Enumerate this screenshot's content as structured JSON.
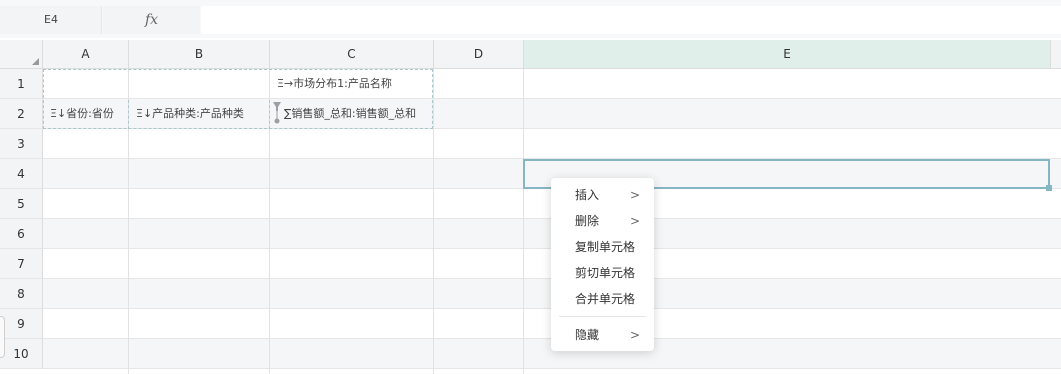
{
  "formula_bar": {
    "cell_ref": "E4",
    "fx_label": "fx",
    "formula_value": ""
  },
  "columns": [
    "A",
    "B",
    "C",
    "D",
    "E"
  ],
  "rows": [
    "1",
    "2",
    "3",
    "4",
    "5",
    "6",
    "7",
    "8",
    "9",
    "10"
  ],
  "cells": {
    "C1": "Ξ→市场分布1:产品名称",
    "A2": "Ξ↓省份:省份",
    "B2": "Ξ↓产品种类:产品种类",
    "C2": "∑销售额_总和:销售额_总和"
  },
  "context_menu": {
    "items": [
      {
        "label": "插入",
        "arrow": ">"
      },
      {
        "label": "删除",
        "arrow": ">"
      },
      {
        "label": "复制单元格",
        "arrow": ""
      },
      {
        "label": "剪切单元格",
        "arrow": ""
      },
      {
        "label": "合并单元格",
        "arrow": ""
      },
      {
        "label": "隐藏",
        "arrow": ">"
      }
    ]
  },
  "colors": {
    "active_column_header": "#e0efe9",
    "selection_border": "#86b6c3",
    "pivot_border": "#a8c7cf"
  },
  "icons": [
    "fx-icon",
    "filter-pin-icon",
    "corner-select-all-icon",
    "submenu-arrow-icon"
  ]
}
